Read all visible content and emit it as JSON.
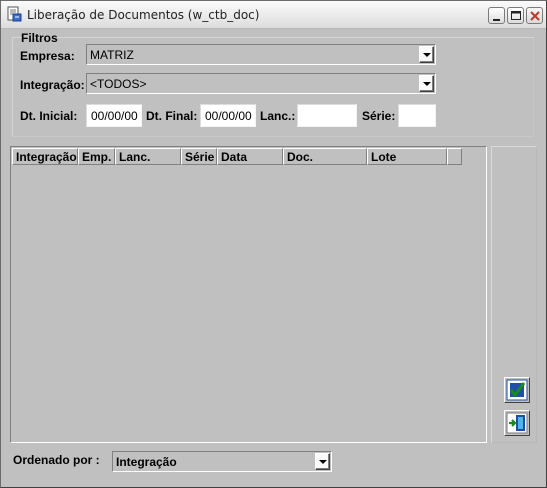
{
  "window": {
    "title": "Liberação de Documentos (w_ctb_doc)",
    "app_icon": "document-app-icon",
    "controls": [
      "minimize-icon",
      "maximize-icon",
      "close-icon"
    ]
  },
  "filters": {
    "group_label": "Filtros",
    "empresa_label": "Empresa:",
    "empresa_value": "MATRIZ",
    "integracao_label": "Integração:",
    "integracao_value": "<TODOS>",
    "dt_inicial_label": "Dt. Inicial:",
    "dt_inicial_value": "00/00/00",
    "dt_final_label": "Dt. Final:",
    "dt_final_value": "00/00/00",
    "lanc_label": "Lanc.:",
    "lanc_value": "",
    "serie_label": "Série:",
    "serie_value": ""
  },
  "grid": {
    "columns": [
      "Integração",
      "Emp.",
      "Lanc.",
      "Série",
      "Data",
      "Doc.",
      "Lote"
    ],
    "rows": []
  },
  "side_buttons": [
    {
      "icon": "confirm-check-icon"
    },
    {
      "icon": "exit-door-icon"
    }
  ],
  "footer": {
    "order_label": "Ordenado por :",
    "order_value": "Integração"
  },
  "colors": {
    "window_bg": "#c0c0c0",
    "field_bg": "#ffffff",
    "icon_accent": "#1f4fa8",
    "check_green": "#1a8a1a"
  }
}
